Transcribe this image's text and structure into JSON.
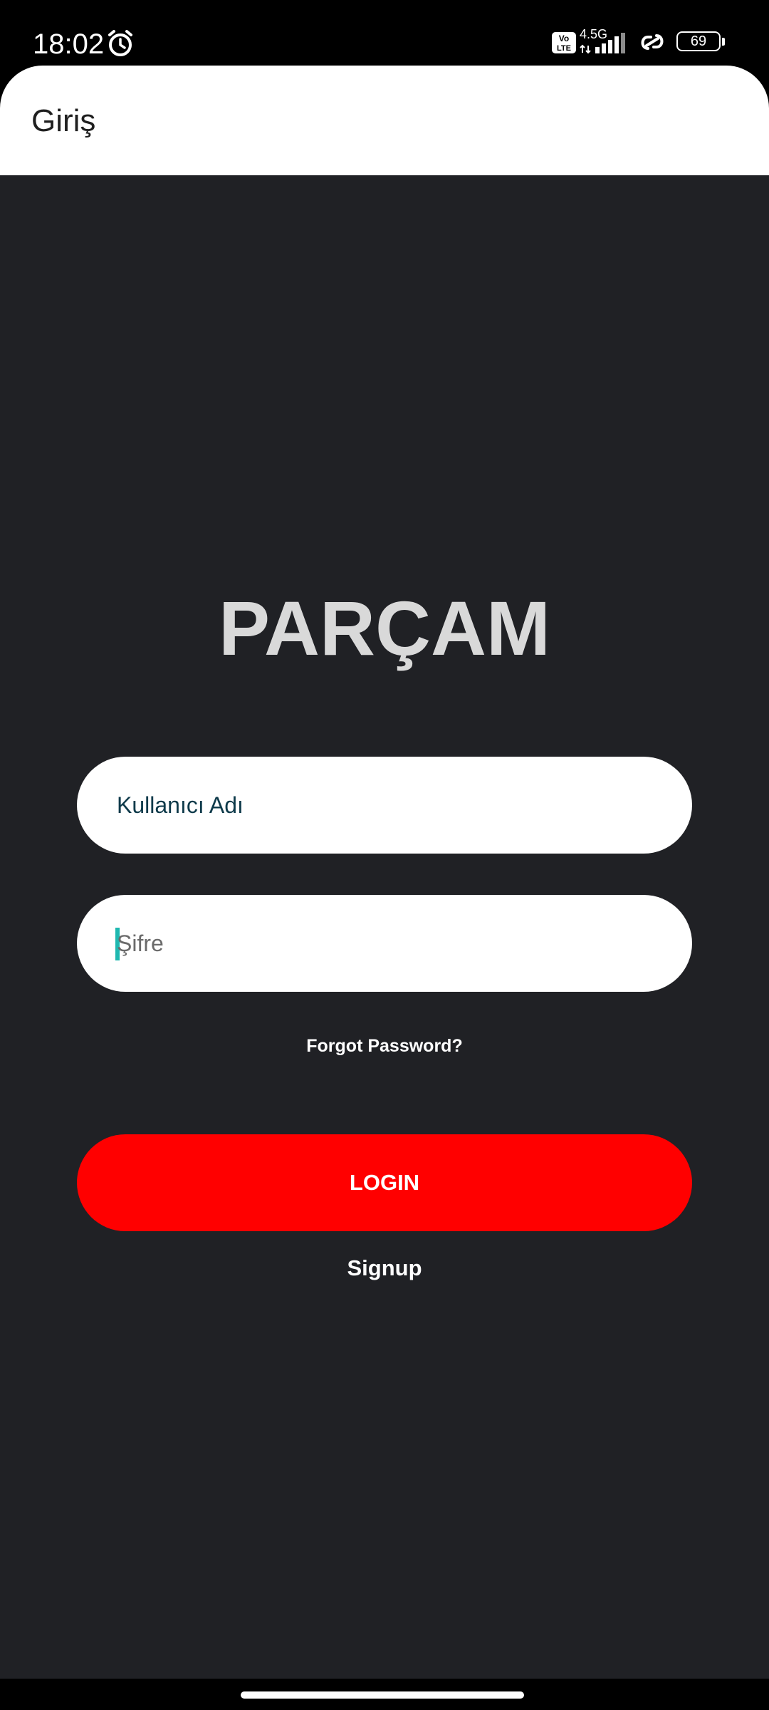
{
  "status_bar": {
    "time": "18:02",
    "network_type": "4.5G",
    "volte_label": "Vo LTE",
    "battery_level": "69",
    "icons": [
      "alarm-icon",
      "volte-icon",
      "signal-icon",
      "link-icon",
      "battery-icon"
    ]
  },
  "app_bar": {
    "title": "Giriş"
  },
  "login": {
    "brand": "PARÇAM",
    "username_placeholder": "Kullanıcı Adı",
    "password_placeholder": "Şifre",
    "forgot_password": "Forgot Password?",
    "login_button": "LOGIN",
    "signup": "Signup"
  },
  "colors": {
    "background": "#202125",
    "brand_text": "#d9d9d9",
    "login_button": "#ff0000",
    "cursor": "#1fb8b0",
    "field_background": "#ffffff"
  }
}
